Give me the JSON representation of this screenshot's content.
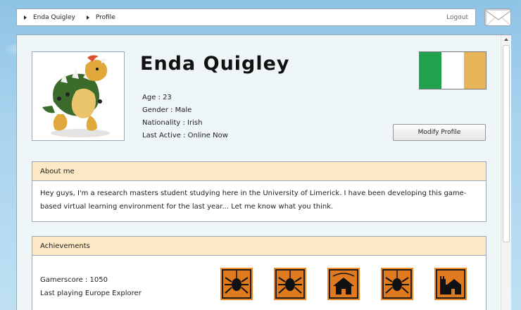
{
  "breadcrumb": [
    "Enda Quigley",
    "Profile"
  ],
  "nav": {
    "logout": "Logout"
  },
  "profile": {
    "name": "Enda Quigley",
    "info": [
      "Age : 23",
      "Gender : Male",
      "Nationality : Irish",
      "Last Active : Online Now"
    ],
    "modify_label": "Modify Profile",
    "flag_colors": [
      "#21a14b",
      "#ffffff",
      "#e8b45a"
    ]
  },
  "about": {
    "title": "About me",
    "text": "Hey guys, I'm a research masters student studying here in the University of Limerick. I have been developing this game-based virtual learning environment for the last year... Let me know what you think."
  },
  "achievements": {
    "title": "Achievements",
    "gamerscore": "Gamerscore : 1050",
    "last_playing": "Last playing Europe Explorer",
    "badges": [
      "spider-icon",
      "spider-icon",
      "house-icon",
      "spider-icon",
      "castle-icon"
    ]
  }
}
